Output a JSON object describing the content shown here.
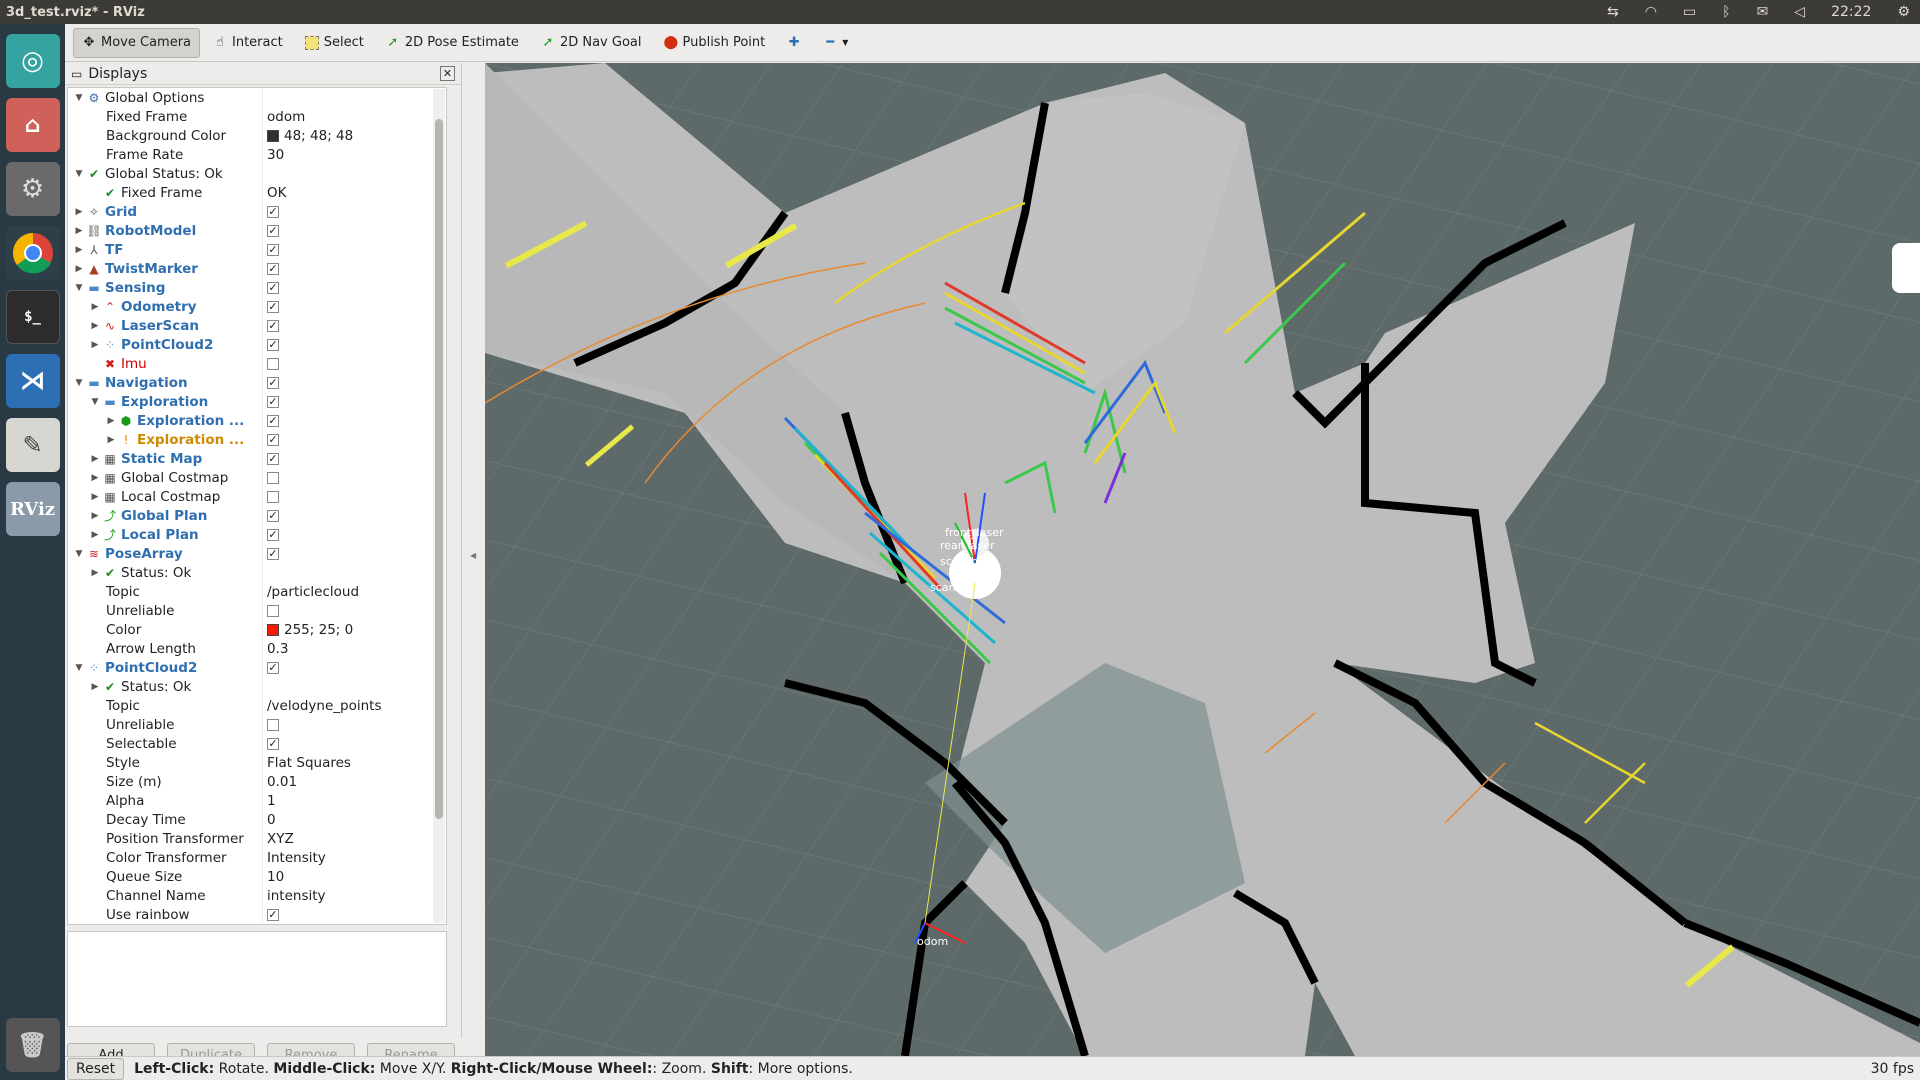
{
  "window": {
    "title": "3d_test.rviz* - RViz"
  },
  "system_tray": {
    "clock": "22:22"
  },
  "toolbar": {
    "tools": [
      {
        "label": "Move Camera",
        "icon": "move-camera-icon",
        "active": true
      },
      {
        "label": "Interact",
        "icon": "interact-icon",
        "active": false
      },
      {
        "label": "Select",
        "icon": "select-icon",
        "active": false
      },
      {
        "label": "2D Pose Estimate",
        "icon": "pose-estimate-icon",
        "active": false
      },
      {
        "label": "2D Nav Goal",
        "icon": "nav-goal-icon",
        "active": false
      },
      {
        "label": "Publish Point",
        "icon": "publish-point-icon",
        "active": false
      }
    ]
  },
  "displays_panel": {
    "title": "Displays",
    "rows": [
      {
        "indent": 0,
        "arrow": "down",
        "icon": "⚙",
        "icon_color": "#3a6fb0",
        "name": "Global Options",
        "style": "",
        "value": ""
      },
      {
        "indent": 1,
        "arrow": "",
        "icon": "",
        "icon_color": "",
        "name": "Fixed Frame",
        "style": "",
        "value": "odom"
      },
      {
        "indent": 1,
        "arrow": "",
        "icon": "",
        "icon_color": "",
        "name": "Background Color",
        "style": "",
        "value": "48; 48; 48",
        "swatch": "#303030"
      },
      {
        "indent": 1,
        "arrow": "",
        "icon": "",
        "icon_color": "",
        "name": "Frame Rate",
        "style": "",
        "value": "30"
      },
      {
        "indent": 0,
        "arrow": "down",
        "icon": "✔",
        "icon_color": "#1a8a1a",
        "name": "Global Status: Ok",
        "style": "",
        "value": ""
      },
      {
        "indent": 1,
        "arrow": "",
        "icon": "✔",
        "icon_color": "#1a8a1a",
        "name": "Fixed Frame",
        "style": "",
        "value": "OK"
      },
      {
        "indent": 0,
        "arrow": "right",
        "icon": "⟡",
        "icon_color": "#555",
        "name": "Grid",
        "style": "blue",
        "check": "on"
      },
      {
        "indent": 0,
        "arrow": "right",
        "icon": "⛓",
        "icon_color": "#555",
        "name": "RobotModel",
        "style": "blue",
        "check": "on"
      },
      {
        "indent": 0,
        "arrow": "right",
        "icon": "⅄",
        "icon_color": "#555",
        "name": "TF",
        "style": "blue",
        "check": "on"
      },
      {
        "indent": 0,
        "arrow": "right",
        "icon": "▲",
        "icon_color": "#a04020",
        "name": "TwistMarker",
        "style": "blue",
        "check": "on"
      },
      {
        "indent": 0,
        "arrow": "down",
        "icon": "▬",
        "icon_color": "#4a88c8",
        "name": "Sensing",
        "style": "blue",
        "check": "on"
      },
      {
        "indent": 1,
        "arrow": "right",
        "icon": "⌃",
        "icon_color": "#c82020",
        "name": "Odometry",
        "style": "blue",
        "check": "on"
      },
      {
        "indent": 1,
        "arrow": "right",
        "icon": "∿",
        "icon_color": "#c82020",
        "name": "LaserScan",
        "style": "blue",
        "check": "on"
      },
      {
        "indent": 1,
        "arrow": "right",
        "icon": "⁘",
        "icon_color": "#4a88c8",
        "name": "PointCloud2",
        "style": "blue",
        "check": "on"
      },
      {
        "indent": 1,
        "arrow": "",
        "icon": "✖",
        "icon_color": "#d02020",
        "name": "Imu",
        "style": "red",
        "check": "off"
      },
      {
        "indent": 0,
        "arrow": "down",
        "icon": "▬",
        "icon_color": "#4a88c8",
        "name": "Navigation",
        "style": "blue",
        "check": "on"
      },
      {
        "indent": 1,
        "arrow": "down",
        "icon": "▬",
        "icon_color": "#4a88c8",
        "name": "Exploration",
        "style": "blue",
        "check": "on"
      },
      {
        "indent": 2,
        "arrow": "right",
        "icon": "⬢",
        "icon_color": "#1a9a1a",
        "name": "Exploration ...",
        "style": "blue",
        "check": "on"
      },
      {
        "indent": 2,
        "arrow": "right",
        "icon": "!",
        "icon_color": "#e08a00",
        "name": "Exploration ...",
        "style": "orange",
        "check": "on"
      },
      {
        "indent": 1,
        "arrow": "right",
        "icon": "▦",
        "icon_color": "#555",
        "name": "Static Map",
        "style": "blue",
        "check": "on"
      },
      {
        "indent": 1,
        "arrow": "right",
        "icon": "▦",
        "icon_color": "#555",
        "name": "Global Costmap",
        "style": "",
        "check": "off"
      },
      {
        "indent": 1,
        "arrow": "right",
        "icon": "▦",
        "icon_color": "#555",
        "name": "Local Costmap",
        "style": "",
        "check": "off"
      },
      {
        "indent": 1,
        "arrow": "right",
        "icon": "⤴",
        "icon_color": "#1a9a1a",
        "name": "Global Plan",
        "style": "blue",
        "check": "on"
      },
      {
        "indent": 1,
        "arrow": "right",
        "icon": "⤴",
        "icon_color": "#1a9a1a",
        "name": "Local Plan",
        "style": "blue",
        "check": "on"
      },
      {
        "indent": 0,
        "arrow": "down",
        "icon": "≋",
        "icon_color": "#c82020",
        "name": "PoseArray",
        "style": "blue",
        "check": "on"
      },
      {
        "indent": 1,
        "arrow": "right",
        "icon": "✔",
        "icon_color": "#1a8a1a",
        "name": "Status: Ok",
        "style": ""
      },
      {
        "indent": 1,
        "arrow": "",
        "icon": "",
        "icon_color": "",
        "name": "Topic",
        "style": "",
        "value": "/particlecloud"
      },
      {
        "indent": 1,
        "arrow": "",
        "icon": "",
        "icon_color": "",
        "name": "Unreliable",
        "style": "",
        "check": "off"
      },
      {
        "indent": 1,
        "arrow": "",
        "icon": "",
        "icon_color": "",
        "name": "Color",
        "style": "",
        "value": "255; 25; 0",
        "swatch": "#ff1900"
      },
      {
        "indent": 1,
        "arrow": "",
        "icon": "",
        "icon_color": "",
        "name": "Arrow Length",
        "style": "",
        "value": "0.3"
      },
      {
        "indent": 0,
        "arrow": "down",
        "icon": "⁘",
        "icon_color": "#4a88c8",
        "name": "PointCloud2",
        "style": "blue",
        "check": "on"
      },
      {
        "indent": 1,
        "arrow": "right",
        "icon": "✔",
        "icon_color": "#1a8a1a",
        "name": "Status: Ok",
        "style": ""
      },
      {
        "indent": 1,
        "arrow": "",
        "icon": "",
        "icon_color": "",
        "name": "Topic",
        "style": "",
        "value": "/velodyne_points"
      },
      {
        "indent": 1,
        "arrow": "",
        "icon": "",
        "icon_color": "",
        "name": "Unreliable",
        "style": "",
        "check": "off"
      },
      {
        "indent": 1,
        "arrow": "",
        "icon": "",
        "icon_color": "",
        "name": "Selectable",
        "style": "",
        "check": "on"
      },
      {
        "indent": 1,
        "arrow": "",
        "icon": "",
        "icon_color": "",
        "name": "Style",
        "style": "",
        "value": "Flat Squares"
      },
      {
        "indent": 1,
        "arrow": "",
        "icon": "",
        "icon_color": "",
        "name": "Size (m)",
        "style": "",
        "value": "0.01"
      },
      {
        "indent": 1,
        "arrow": "",
        "icon": "",
        "icon_color": "",
        "name": "Alpha",
        "style": "",
        "value": "1"
      },
      {
        "indent": 1,
        "arrow": "",
        "icon": "",
        "icon_color": "",
        "name": "Decay Time",
        "style": "",
        "value": "0"
      },
      {
        "indent": 1,
        "arrow": "",
        "icon": "",
        "icon_color": "",
        "name": "Position Transformer",
        "style": "",
        "value": "XYZ"
      },
      {
        "indent": 1,
        "arrow": "",
        "icon": "",
        "icon_color": "",
        "name": "Color Transformer",
        "style": "",
        "value": "Intensity"
      },
      {
        "indent": 1,
        "arrow": "",
        "icon": "",
        "icon_color": "",
        "name": "Queue Size",
        "style": "",
        "value": "10"
      },
      {
        "indent": 1,
        "arrow": "",
        "icon": "",
        "icon_color": "",
        "name": "Channel Name",
        "style": "",
        "value": "intensity"
      },
      {
        "indent": 1,
        "arrow": "",
        "icon": "",
        "icon_color": "",
        "name": "Use rainbow",
        "style": "",
        "check": "on"
      }
    ],
    "buttons": {
      "add": "Add",
      "duplicate": "Duplicate",
      "remove": "Remove",
      "rename": "Rename"
    }
  },
  "statusbar": {
    "reset": "Reset",
    "hints": [
      {
        "key": "Left-Click:",
        "text": " Rotate. "
      },
      {
        "key": "Middle-Click:",
        "text": " Move X/Y. "
      },
      {
        "key": "Right-Click/Mouse Wheel:",
        "text": ": Zoom. "
      },
      {
        "key": "Shift",
        "text": ": More options."
      }
    ],
    "fps": "30 fps"
  },
  "view": {
    "frame_labels": [
      "front_laser",
      "rear_laser",
      "scan_base",
      "scan",
      "odom"
    ]
  },
  "colors": {
    "map_free": "#bdbdbd",
    "map_occupied": "#000000",
    "map_unknown": "#5e6a6a",
    "grid": "#7f8a8a"
  }
}
